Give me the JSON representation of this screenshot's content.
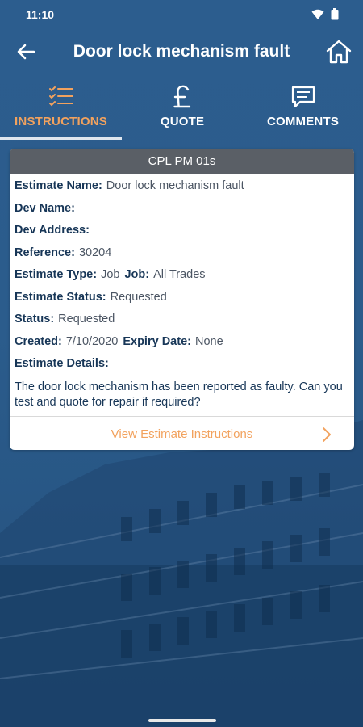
{
  "status_bar": {
    "time": "11:10"
  },
  "app_bar": {
    "title": "Door lock mechanism fault"
  },
  "tabs": [
    {
      "label": "INSTRUCTIONS",
      "icon": "checklist-icon",
      "active": true
    },
    {
      "label": "QUOTE",
      "icon": "pound-icon",
      "active": false
    },
    {
      "label": "COMMENTS",
      "icon": "comment-icon",
      "active": false
    }
  ],
  "card": {
    "header": "CPL PM 01s",
    "fields": {
      "estimate_name_label": "Estimate Name:",
      "estimate_name_value": "Door lock mechanism fault",
      "dev_name_label": "Dev Name:",
      "dev_address_label": "Dev Address:",
      "reference_label": "Reference:",
      "reference_value": "30204",
      "estimate_type_label": "Estimate Type:",
      "estimate_type_value": "Job",
      "job_label": "Job:",
      "job_value": "All Trades",
      "estimate_status_label": "Estimate Status:",
      "estimate_status_value": "Requested",
      "status_label": "Status:",
      "status_value": "Requested",
      "created_label": "Created:",
      "created_value": "7/10/2020",
      "expiry_label": "Expiry Date:",
      "expiry_value": "None",
      "details_label": "Estimate Details:",
      "details_text": "The door lock mechanism has been reported as faulty. Can you test and quote for repair if required?"
    },
    "link_label": "View Estimate Instructions"
  },
  "colors": {
    "accent": "#f2a25e",
    "background": "#2c5d8e",
    "header_bg": "#5a5f66",
    "label": "#173657"
  }
}
